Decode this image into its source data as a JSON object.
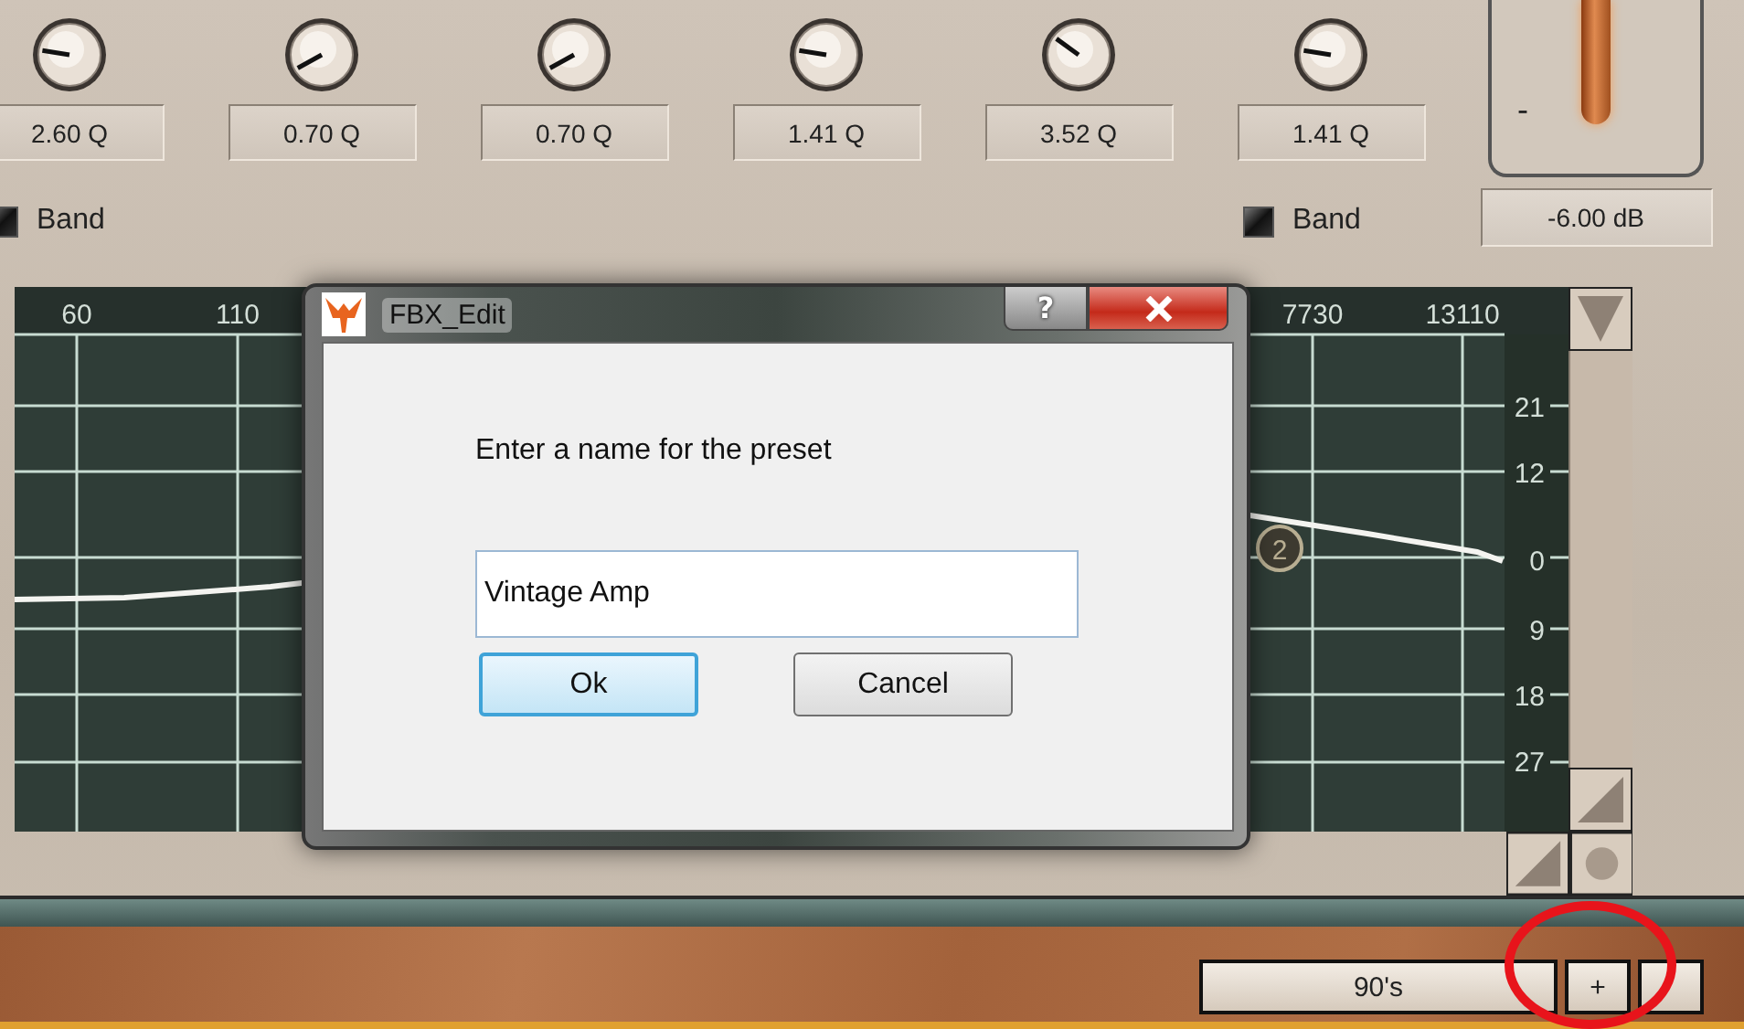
{
  "knobs": [
    {
      "value": "2.60 Q"
    },
    {
      "value": "0.70 Q"
    },
    {
      "value": "0.70 Q"
    },
    {
      "value": "1.41 Q"
    },
    {
      "value": "3.52 Q"
    },
    {
      "value": "1.41 Q"
    }
  ],
  "bands": [
    {
      "label": "Band",
      "checked": true
    },
    {
      "label": "Band",
      "checked": true
    }
  ],
  "output": {
    "fader_sign": "-",
    "gain": "-6.00 dB"
  },
  "graph": {
    "x_labels": [
      "60",
      "110",
      "7730",
      "13110"
    ],
    "y_labels": [
      "21",
      "12",
      "0",
      "9",
      "18",
      "27"
    ],
    "band_marker": "2"
  },
  "dialog": {
    "title": "FBX_Edit",
    "help": "?",
    "prompt": "Enter a name for the preset",
    "value": "Vintage Amp",
    "buttons": [
      {
        "label": "Ok",
        "selected": true
      },
      {
        "label": "Cancel",
        "selected": false
      }
    ]
  },
  "presets": {
    "name": "90's",
    "add": "+"
  }
}
